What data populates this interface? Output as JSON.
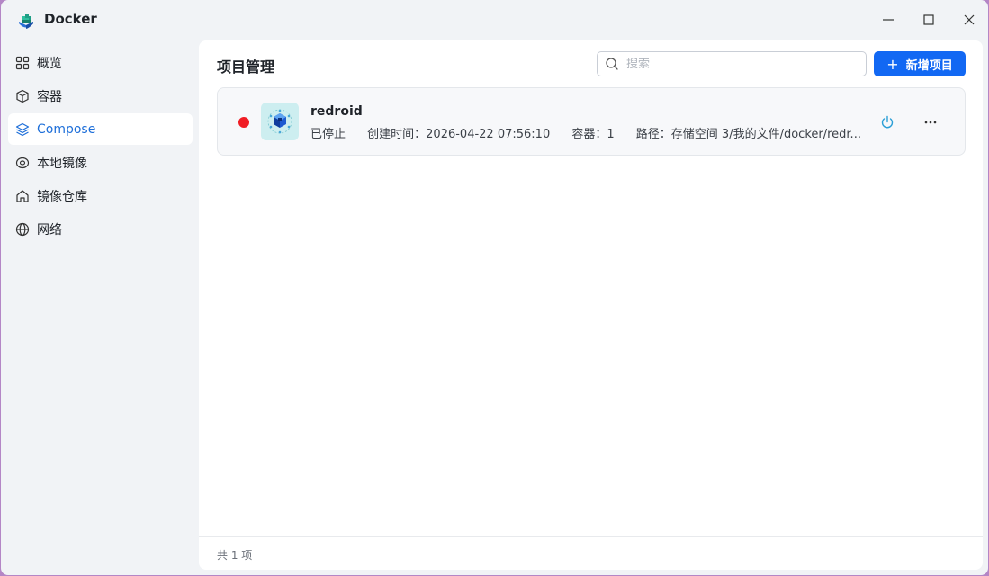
{
  "window": {
    "title": "Docker"
  },
  "sidebar": {
    "items": [
      {
        "label": "概览",
        "icon": "grid-icon"
      },
      {
        "label": "容器",
        "icon": "box-icon"
      },
      {
        "label": "Compose",
        "icon": "layers-icon",
        "active": true
      },
      {
        "label": "本地镜像",
        "icon": "disc-icon"
      },
      {
        "label": "镜像仓库",
        "icon": "home-icon"
      },
      {
        "label": "网络",
        "icon": "globe-icon"
      }
    ]
  },
  "main": {
    "title": "项目管理",
    "search": {
      "placeholder": "搜索",
      "value": ""
    },
    "add_button_label": "新增项目",
    "projects": [
      {
        "name": "redroid",
        "status": "已停止",
        "status_color": "#f01d24",
        "created": "创建时间：2026-04-22 07:56:10",
        "containers": "容器：1",
        "path": "路径：存储空间 3/我的文件/docker/redr..."
      }
    ],
    "footer_count": "共 1 项"
  },
  "colors": {
    "accent": "#1268f3",
    "active_nav": "#1e6fd9",
    "power": "#2c9fd6"
  }
}
